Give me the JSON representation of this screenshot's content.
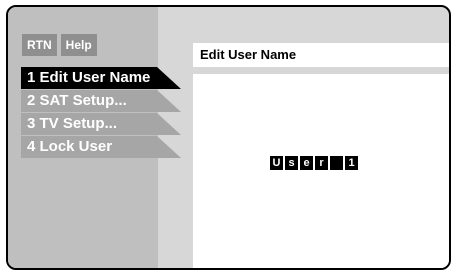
{
  "buttons": {
    "rtn": "RTN",
    "help": "Help"
  },
  "menu": {
    "items": [
      {
        "label": "1 Edit User Name",
        "active": true
      },
      {
        "label": "2 SAT Setup...",
        "active": false
      },
      {
        "label": "3 TV Setup...",
        "active": false
      },
      {
        "label": "4 Lock User",
        "active": false
      }
    ]
  },
  "panel": {
    "title": "Edit User Name",
    "user_name_chars": [
      "U",
      "s",
      "e",
      "r",
      " ",
      "1"
    ]
  }
}
